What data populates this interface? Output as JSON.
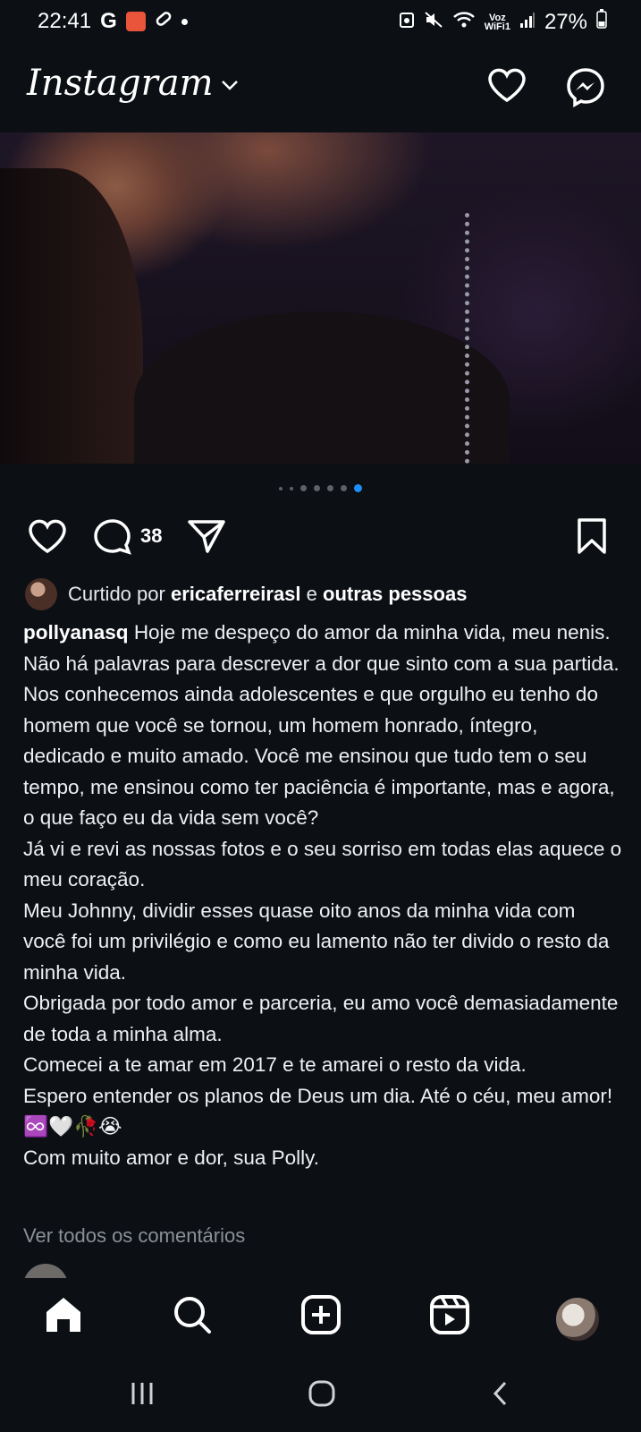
{
  "status_bar": {
    "time": "22:41",
    "left_icons": [
      "google-g-icon",
      "app-grid-icon",
      "pill-icon",
      "notification-dot-icon"
    ],
    "g_label": "G",
    "volte_label_top": "Voz",
    "volte_label_bottom": "WiFi1",
    "battery": "27%",
    "right_icons": [
      "alarm-icon",
      "mute-icon",
      "wifi-icon",
      "volte-icon",
      "signal-icon",
      "battery-icon"
    ]
  },
  "header": {
    "logo": "Instagram",
    "icons": [
      "chevron-down-icon",
      "heart-icon",
      "messenger-icon"
    ]
  },
  "post": {
    "carousel": {
      "total": 7,
      "active_index": 6
    },
    "actions": {
      "comment_count": "38",
      "icons": [
        "heart-icon",
        "comment-icon",
        "share-icon",
        "bookmark-icon"
      ]
    },
    "likes": {
      "prefix": "Curtido por",
      "user": "ericaferreirasl",
      "conjunction": "e",
      "others": "outras pessoas"
    },
    "caption": {
      "username": "pollyanasq",
      "paragraphs": [
        "Hoje me despeço do amor da minha vida, meu nenis. Não há palavras para descrever a dor que sinto com a sua partida. Nos conhecemos ainda adolescentes e que orgulho eu tenho do homem que você se tornou, um homem honrado, íntegro, dedicado e muito amado. Você me ensinou que tudo tem o seu tempo, me ensinou como ter paciência é importante, mas e agora, o que faço eu da vida sem você?",
        "Já vi e revi as nossas fotos e o seu sorriso em todas elas aquece o meu coração.",
        "Meu Johnny, dividir esses quase oito anos da minha vida com você foi um privilégio e como eu lamento não ter divido o resto da minha vida.",
        "Obrigada por todo amor e parceria, eu amo você demasiadamente de toda a minha alma.",
        "Comecei a te amar em 2017 e te amarei o resto da vida.",
        "Espero entender os planos de Deus um dia. Até o céu, meu amor! ♾️🤍🥀😭",
        "Com muito amor e dor, sua Polly."
      ]
    },
    "view_all_comments": "Ver todos os comentários"
  },
  "bottom_nav": {
    "items": [
      "home-icon",
      "search-icon",
      "create-icon",
      "reels-icon",
      "profile-avatar"
    ]
  },
  "system_nav": {
    "items": [
      "recent-apps-icon",
      "home-circle-icon",
      "back-icon"
    ]
  },
  "colors": {
    "background": "#0c0f14",
    "accent": "#1d8ef5",
    "muted": "#8b9097"
  }
}
